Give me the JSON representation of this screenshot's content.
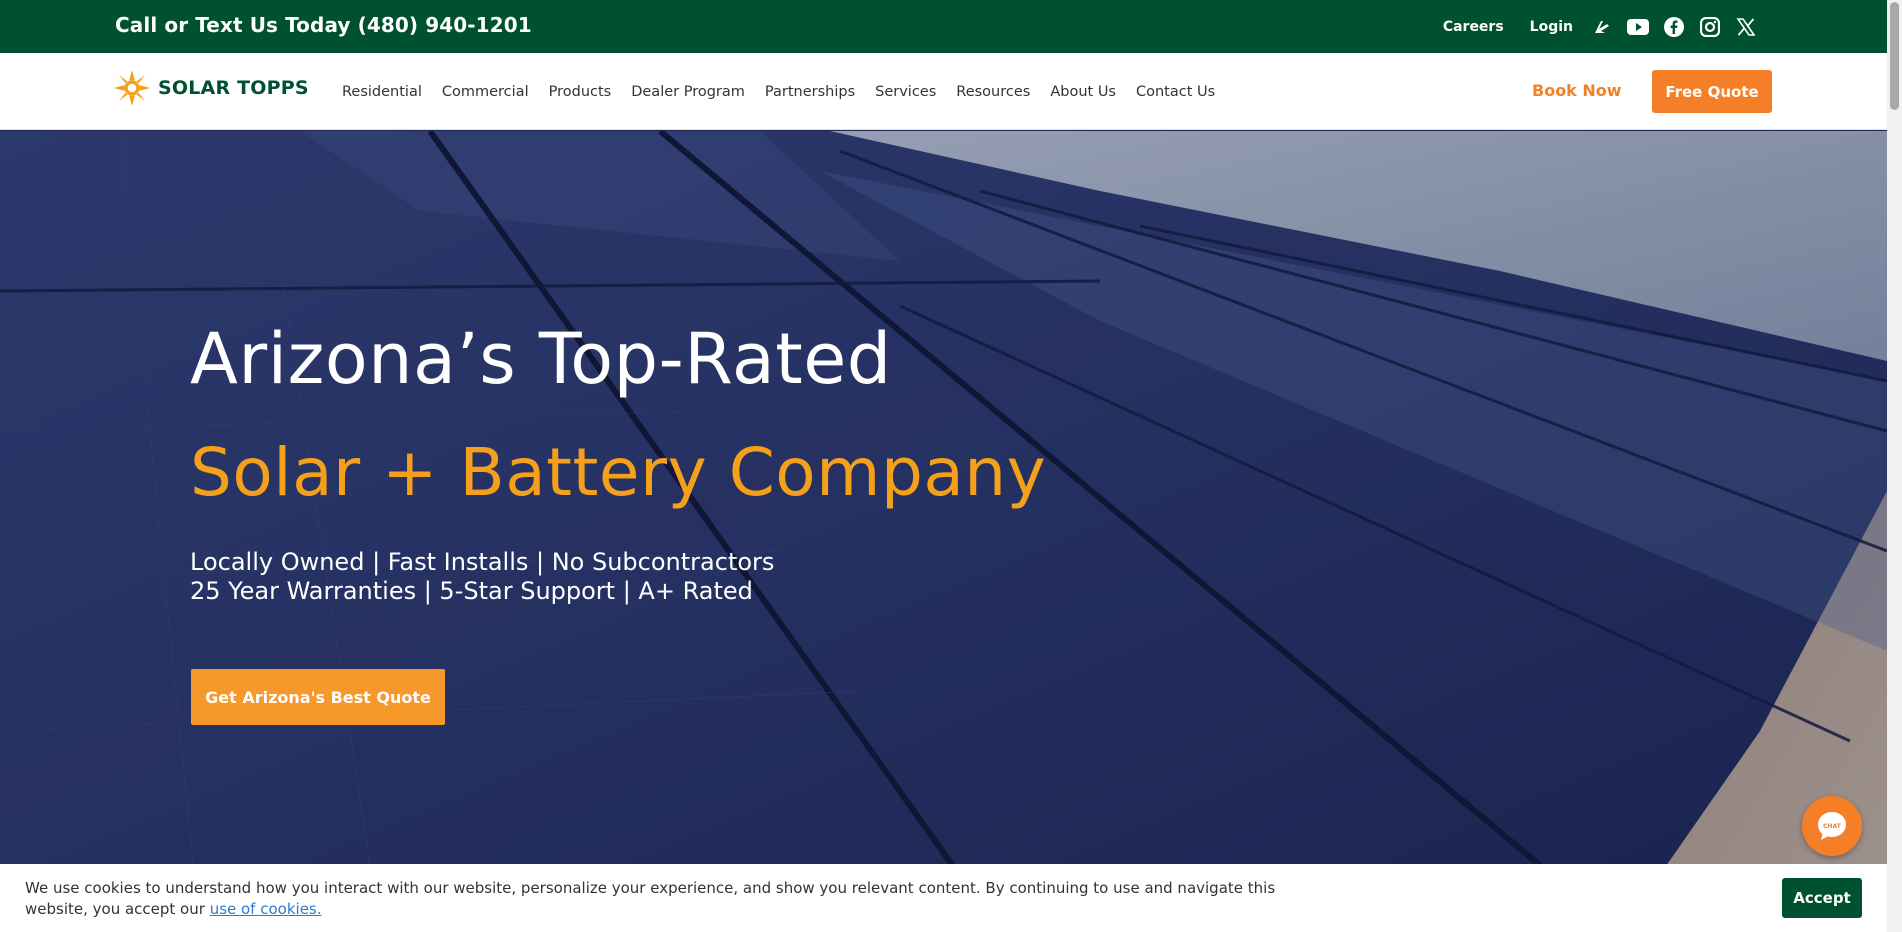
{
  "topbar": {
    "phone": "Call or Text Us Today (480) 940-1201",
    "careers": "Careers",
    "login": "Login",
    "social": [
      "nextdoor-icon",
      "youtube-icon",
      "facebook-icon",
      "instagram-icon",
      "x-icon"
    ]
  },
  "nav": {
    "logo": "SOLAR TOPPS",
    "items": [
      "Residential",
      "Commercial",
      "Products",
      "Dealer Program",
      "Partnerships",
      "Services",
      "Resources",
      "About Us",
      "Contact Us"
    ],
    "book_now": "Book Now",
    "free_quote": "Free Quote"
  },
  "hero": {
    "title": "Arizona’s Top-Rated",
    "subtitle": "Solar + Battery Company",
    "tagline_1": "Locally Owned | Fast Installs | No Subcontractors",
    "tagline_2": "25 Year Warranties | 5-Star Support | A+ Rated",
    "cta": "Get Arizona's Best Quote"
  },
  "chat": {
    "label": "CHAT"
  },
  "cookie": {
    "text": "We use cookies to understand how you interact with our website, personalize your experience, and show you relevant content. By continuing to use and navigate this website, you accept our ",
    "link": "use of cookies.",
    "accept": "Accept"
  },
  "colors": {
    "brand_green": "#005130",
    "brand_orange": "#f47f27",
    "hero_accent": "#f5a01a"
  }
}
